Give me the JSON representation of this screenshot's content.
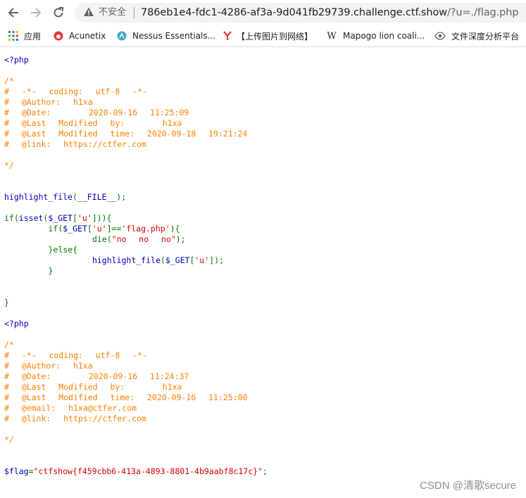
{
  "browser": {
    "insecure_label": "不安全",
    "url_host": "786eb1e4-fdc1-4286-af3a-9d041fb29739.challenge.ctf.show",
    "url_path": "/?u=./flag.php"
  },
  "bookmarks": [
    {
      "label": "应用",
      "icon": "apps-grid-icon"
    },
    {
      "label": "Acunetix",
      "icon": "acunetix-icon"
    },
    {
      "label": "Nessus Essentials...",
      "icon": "nessus-icon"
    },
    {
      "label": "【上传图片到网络】",
      "icon": "y-logo-icon"
    },
    {
      "label": "Mapogo lion coali...",
      "icon": "wikipedia-w-icon"
    },
    {
      "label": "文件深度分析平台",
      "icon": "eye-icon"
    }
  ],
  "code": {
    "file1": {
      "open_tag": "<?php",
      "header": [
        "/*",
        "#  -*-  coding:  utf-8  -*-",
        "#  @Author:  h1xa",
        "#  @Date:      2020-09-16  11:25:09",
        "#  @Last  Modified  by:      h1xa",
        "#  @Last  Modified  time:  2020-09-18  19:21:24",
        "#  @link:  https://ctfer.com",
        "",
        "*/"
      ],
      "fn_highlight": "highlight_file",
      "file_const": "__FILE__",
      "kw_if": "if",
      "fn_isset": "isset",
      "get_var": "$_GET",
      "key_u": "'u'",
      "str_flag": "'flag.php'",
      "fn_die": "die",
      "str_no": "\"no  no  no\"",
      "kw_else": "else"
    },
    "file2": {
      "open_tag": "<?php",
      "header": [
        "/*",
        "#  -*-  coding:  utf-8  -*-",
        "#  @Author:  h1xa",
        "#  @Date:      2020-09-16  11:24:37",
        "#  @Last  Modified  by:      h1xa",
        "#  @Last  Modified  time:  2020-09-16  11:25:00",
        "#  @email:  h1xa@ctfer.com",
        "#  @link:  https://ctfer.com",
        "",
        "*/"
      ],
      "flag_var": "$flag",
      "flag_value": "\"ctfshow{f459cbb6-413a-4893-8801-4b9aabf8c17c}\""
    }
  },
  "watermark": "CSDN @清歌secure",
  "colors": {
    "php_default": "#0000BB",
    "php_comment": "#FF8000",
    "php_keyword": "#007700",
    "php_string": "#DD0000"
  }
}
